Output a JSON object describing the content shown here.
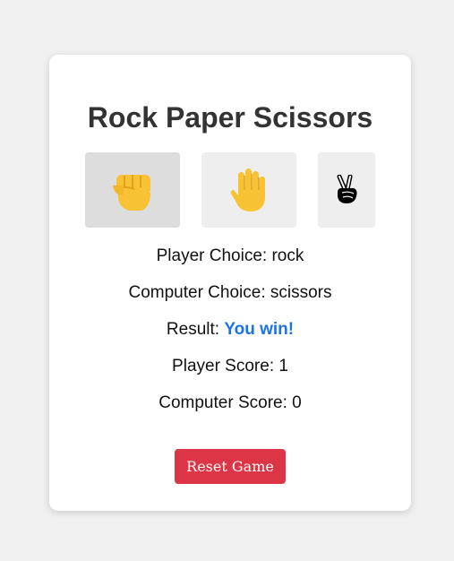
{
  "game": {
    "title": "Rock Paper Scissors",
    "choices": [
      {
        "name": "rock",
        "icon": "raised-fist-icon",
        "selected": true
      },
      {
        "name": "paper",
        "icon": "raised-hand-icon",
        "selected": false
      },
      {
        "name": "scissors",
        "icon": "victory-hand-icon",
        "selected": false
      }
    ],
    "player_choice_label": "Player Choice:",
    "player_choice_value": "rock",
    "computer_choice_label": "Computer Choice:",
    "computer_choice_value": "scissors",
    "result_label": "Result:",
    "result_value": "You win!",
    "player_score_label": "Player Score:",
    "player_score_value": "1",
    "computer_score_label": "Computer Score:",
    "computer_score_value": "0",
    "reset_label": "Reset Game"
  },
  "colors": {
    "page_bg": "#f0f0f0",
    "card_bg": "#ffffff",
    "title": "#333333",
    "result_accent": "#1a73e8",
    "reset_button": "#dc3545",
    "choice_bg": "#eeeeee",
    "choice_selected_bg": "#dddddd"
  }
}
